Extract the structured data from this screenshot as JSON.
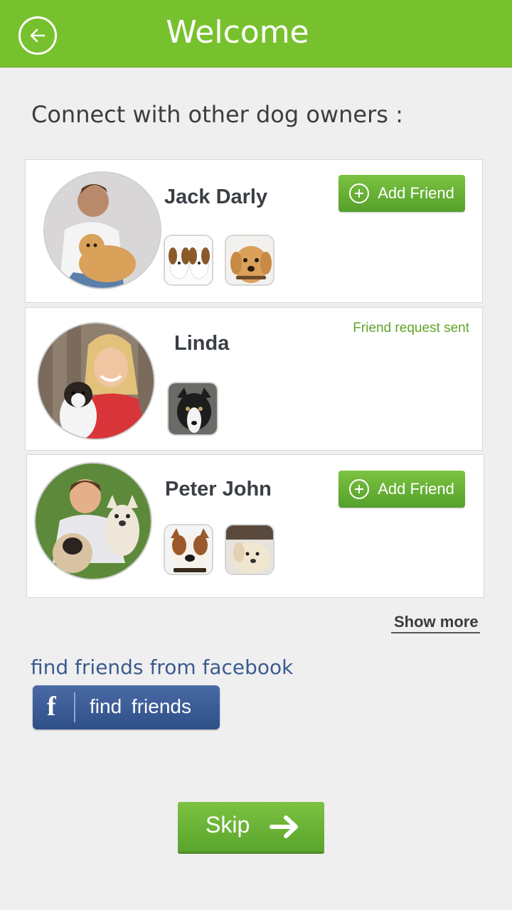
{
  "header": {
    "title": "Welcome",
    "back_icon": "arrow-left-circle-icon",
    "color": "#78c12e"
  },
  "intro_text": "Connect with other dog owners :",
  "users": [
    {
      "name": "Jack Darly",
      "action": "Add Friend",
      "dogs": [
        "two-puppies-photo",
        "golden-retriever-photo"
      ]
    },
    {
      "name": "Linda",
      "status": "Friend request sent",
      "dogs": [
        "border-collie-photo"
      ]
    },
    {
      "name": "Peter John",
      "action": "Add Friend",
      "dogs": [
        "bulldog-photo",
        "labrador-puppy-photo"
      ]
    }
  ],
  "show_more": "Show more",
  "facebook": {
    "label": "find friends from facebook",
    "button_icon": "facebook-f",
    "button_text": "find friends",
    "color": "#3b5b8f"
  },
  "skip": {
    "label": "Skip",
    "icon": "arrow-right-icon"
  }
}
